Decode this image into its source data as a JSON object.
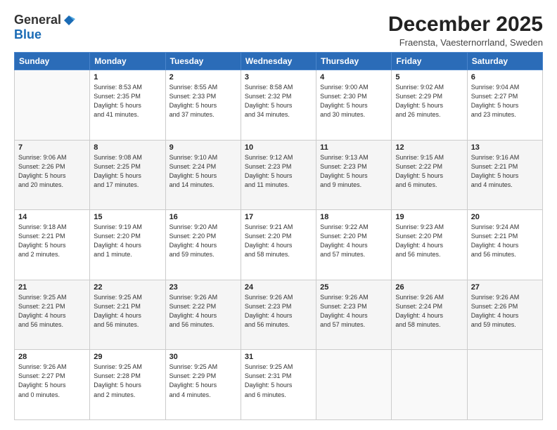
{
  "logo": {
    "general": "General",
    "blue": "Blue"
  },
  "title": "December 2025",
  "subtitle": "Fraensta, Vaesternorrland, Sweden",
  "days_of_week": [
    "Sunday",
    "Monday",
    "Tuesday",
    "Wednesday",
    "Thursday",
    "Friday",
    "Saturday"
  ],
  "weeks": [
    [
      {
        "num": "",
        "info": ""
      },
      {
        "num": "1",
        "info": "Sunrise: 8:53 AM\nSunset: 2:35 PM\nDaylight: 5 hours\nand 41 minutes."
      },
      {
        "num": "2",
        "info": "Sunrise: 8:55 AM\nSunset: 2:33 PM\nDaylight: 5 hours\nand 37 minutes."
      },
      {
        "num": "3",
        "info": "Sunrise: 8:58 AM\nSunset: 2:32 PM\nDaylight: 5 hours\nand 34 minutes."
      },
      {
        "num": "4",
        "info": "Sunrise: 9:00 AM\nSunset: 2:30 PM\nDaylight: 5 hours\nand 30 minutes."
      },
      {
        "num": "5",
        "info": "Sunrise: 9:02 AM\nSunset: 2:29 PM\nDaylight: 5 hours\nand 26 minutes."
      },
      {
        "num": "6",
        "info": "Sunrise: 9:04 AM\nSunset: 2:27 PM\nDaylight: 5 hours\nand 23 minutes."
      }
    ],
    [
      {
        "num": "7",
        "info": "Sunrise: 9:06 AM\nSunset: 2:26 PM\nDaylight: 5 hours\nand 20 minutes."
      },
      {
        "num": "8",
        "info": "Sunrise: 9:08 AM\nSunset: 2:25 PM\nDaylight: 5 hours\nand 17 minutes."
      },
      {
        "num": "9",
        "info": "Sunrise: 9:10 AM\nSunset: 2:24 PM\nDaylight: 5 hours\nand 14 minutes."
      },
      {
        "num": "10",
        "info": "Sunrise: 9:12 AM\nSunset: 2:23 PM\nDaylight: 5 hours\nand 11 minutes."
      },
      {
        "num": "11",
        "info": "Sunrise: 9:13 AM\nSunset: 2:23 PM\nDaylight: 5 hours\nand 9 minutes."
      },
      {
        "num": "12",
        "info": "Sunrise: 9:15 AM\nSunset: 2:22 PM\nDaylight: 5 hours\nand 6 minutes."
      },
      {
        "num": "13",
        "info": "Sunrise: 9:16 AM\nSunset: 2:21 PM\nDaylight: 5 hours\nand 4 minutes."
      }
    ],
    [
      {
        "num": "14",
        "info": "Sunrise: 9:18 AM\nSunset: 2:21 PM\nDaylight: 5 hours\nand 2 minutes."
      },
      {
        "num": "15",
        "info": "Sunrise: 9:19 AM\nSunset: 2:20 PM\nDaylight: 4 hours\nand 1 minute."
      },
      {
        "num": "16",
        "info": "Sunrise: 9:20 AM\nSunset: 2:20 PM\nDaylight: 4 hours\nand 59 minutes."
      },
      {
        "num": "17",
        "info": "Sunrise: 9:21 AM\nSunset: 2:20 PM\nDaylight: 4 hours\nand 58 minutes."
      },
      {
        "num": "18",
        "info": "Sunrise: 9:22 AM\nSunset: 2:20 PM\nDaylight: 4 hours\nand 57 minutes."
      },
      {
        "num": "19",
        "info": "Sunrise: 9:23 AM\nSunset: 2:20 PM\nDaylight: 4 hours\nand 56 minutes."
      },
      {
        "num": "20",
        "info": "Sunrise: 9:24 AM\nSunset: 2:21 PM\nDaylight: 4 hours\nand 56 minutes."
      }
    ],
    [
      {
        "num": "21",
        "info": "Sunrise: 9:25 AM\nSunset: 2:21 PM\nDaylight: 4 hours\nand 56 minutes."
      },
      {
        "num": "22",
        "info": "Sunrise: 9:25 AM\nSunset: 2:21 PM\nDaylight: 4 hours\nand 56 minutes."
      },
      {
        "num": "23",
        "info": "Sunrise: 9:26 AM\nSunset: 2:22 PM\nDaylight: 4 hours\nand 56 minutes."
      },
      {
        "num": "24",
        "info": "Sunrise: 9:26 AM\nSunset: 2:23 PM\nDaylight: 4 hours\nand 56 minutes."
      },
      {
        "num": "25",
        "info": "Sunrise: 9:26 AM\nSunset: 2:23 PM\nDaylight: 4 hours\nand 57 minutes."
      },
      {
        "num": "26",
        "info": "Sunrise: 9:26 AM\nSunset: 2:24 PM\nDaylight: 4 hours\nand 58 minutes."
      },
      {
        "num": "27",
        "info": "Sunrise: 9:26 AM\nSunset: 2:26 PM\nDaylight: 4 hours\nand 59 minutes."
      }
    ],
    [
      {
        "num": "28",
        "info": "Sunrise: 9:26 AM\nSunset: 2:27 PM\nDaylight: 5 hours\nand 0 minutes."
      },
      {
        "num": "29",
        "info": "Sunrise: 9:25 AM\nSunset: 2:28 PM\nDaylight: 5 hours\nand 2 minutes."
      },
      {
        "num": "30",
        "info": "Sunrise: 9:25 AM\nSunset: 2:29 PM\nDaylight: 5 hours\nand 4 minutes."
      },
      {
        "num": "31",
        "info": "Sunrise: 9:25 AM\nSunset: 2:31 PM\nDaylight: 5 hours\nand 6 minutes."
      },
      {
        "num": "",
        "info": ""
      },
      {
        "num": "",
        "info": ""
      },
      {
        "num": "",
        "info": ""
      }
    ]
  ]
}
